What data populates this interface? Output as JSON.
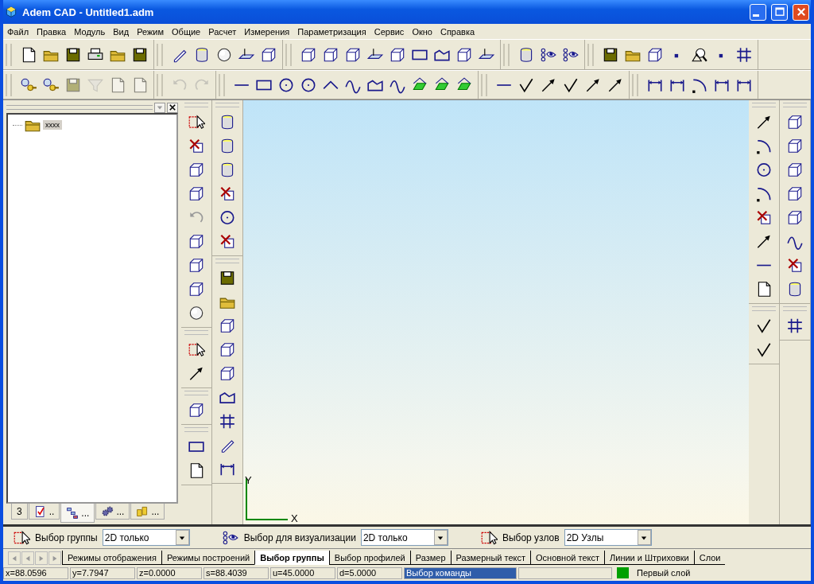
{
  "window": {
    "title": "Adem CAD - Untitled1.adm"
  },
  "menu": [
    "Файл",
    "Правка",
    "Модуль",
    "Вид",
    "Режим",
    "Общие",
    "Расчет",
    "Измерения",
    "Параметризация",
    "Сервис",
    "Окно",
    "Справка"
  ],
  "tree": {
    "items": [
      {
        "label": "xxxx",
        "selected": true
      }
    ]
  },
  "panel_tabs": [
    {
      "label": "3",
      "selected": false
    },
    {
      "label": "..",
      "selected": false
    },
    {
      "label": "...",
      "selected": true
    },
    {
      "label": "...",
      "selected": false
    },
    {
      "label": "...",
      "selected": false
    }
  ],
  "canvas": {
    "axis_y": "Y",
    "axis_x": "X"
  },
  "selection_bar": [
    {
      "label": "Выбор группы",
      "value": "2D только"
    },
    {
      "label": "Выбор для визуализации",
      "value": "2D только"
    },
    {
      "label": "Выбор узлов",
      "value": "2D Узлы"
    }
  ],
  "tabs": [
    {
      "label": "Режимы отображения",
      "selected": false
    },
    {
      "label": "Режимы построений",
      "selected": false
    },
    {
      "label": "Выбор группы",
      "selected": true
    },
    {
      "label": "Выбор профилей",
      "selected": false
    },
    {
      "label": "Размер",
      "selected": false
    },
    {
      "label": "Размерный текст",
      "selected": false
    },
    {
      "label": "Основной текст",
      "selected": false
    },
    {
      "label": "Линии и Штриховки",
      "selected": false
    },
    {
      "label": "Слои",
      "selected": false
    }
  ],
  "status_bar": {
    "fields": [
      {
        "text": "x=88.0596",
        "kind": "value"
      },
      {
        "text": "y=7.7947",
        "kind": "value"
      },
      {
        "text": "z=0.0000",
        "kind": "value"
      },
      {
        "text": "s=88.4039",
        "kind": "value"
      },
      {
        "text": "u=45.0000",
        "kind": "value"
      },
      {
        "text": "d=5.0000",
        "kind": "value"
      },
      {
        "text": "Выбор команды",
        "kind": "prompt"
      }
    ],
    "layer": {
      "label": "Первый слой",
      "color": "#00a000"
    }
  }
}
